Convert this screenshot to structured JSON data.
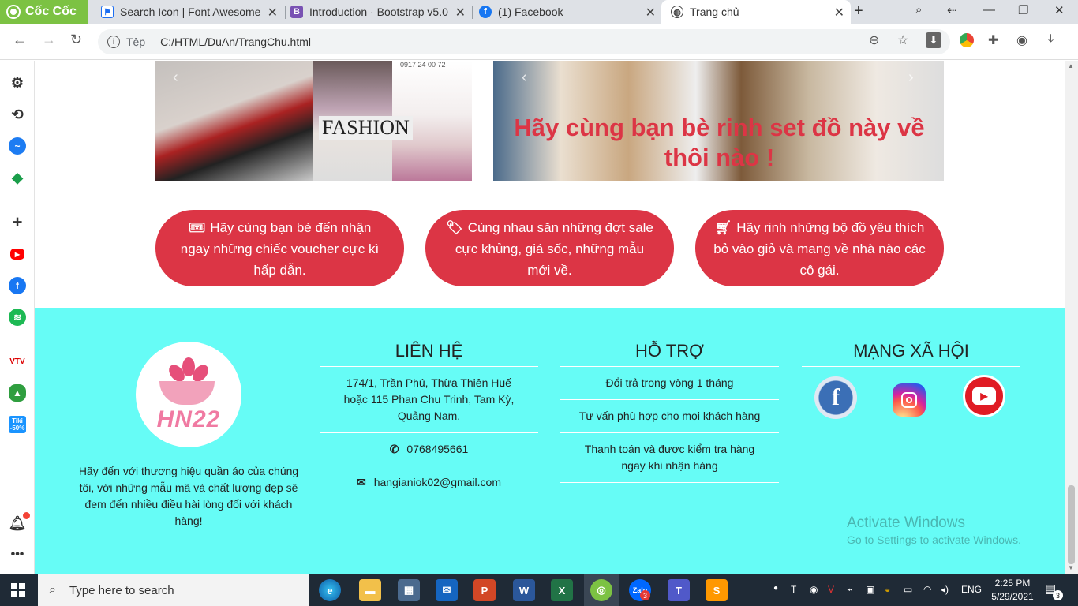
{
  "browser": {
    "brand": "Cốc Cốc",
    "tabs": [
      {
        "label": "Search Icon | Font Awesome",
        "icon": "flag-icon"
      },
      {
        "label": "Introduction · Bootstrap v5.0",
        "icon": "bootstrap-icon"
      },
      {
        "label": "(1) Facebook",
        "icon": "facebook-icon"
      },
      {
        "label": "Trang chủ",
        "icon": "globe-icon"
      }
    ],
    "address_label": "Tệp",
    "url": "C:/HTML/DuAn/TrangChu.html"
  },
  "banner": {
    "left_text": "FASHION",
    "right_caption": "Hãy cùng bạn bè rinh set đồ này về thôi nào !",
    "phone_fragment": "0917 24 00 72"
  },
  "promos": [
    {
      "icon": "ticket-icon",
      "text": "Hãy cùng bạn bè đến nhận ngay những chiếc voucher cực kì hấp dẫn."
    },
    {
      "icon": "tags-icon",
      "text": "Cùng nhau săn những đợt sale cực khủng, giá sốc, những mẫu mới về."
    },
    {
      "icon": "cart-icon",
      "text": "Hãy rinh những bộ đồ yêu thích bỏ vào giỏ và mang về nhà nào các cô gái."
    }
  ],
  "footer": {
    "logo_text": "HN22",
    "about": "Hãy đến với thương hiệu quần áo của chúng tôi, với những mẫu mã và chất lượng đẹp sẽ đem đến nhiều điều hài lòng đối với khách hàng!",
    "contact": {
      "title": "LIÊN HỆ",
      "address": "174/1, Trần Phú, Thừa Thiên Huế hoặc 115 Phan Chu Trinh, Tam Kỳ, Quảng Nam.",
      "phone": "0768495661",
      "email": "hangianiok02@gmail.com"
    },
    "support": {
      "title": "HỖ TRỢ",
      "items": [
        "Đổi trả trong vòng 1 tháng",
        "Tư vấn phù hợp cho mọi khách hàng",
        "Thanh toán và được kiểm tra hàng ngay khi nhận hàng"
      ]
    },
    "social": {
      "title": "MẠNG XÃ HỘI",
      "facebook_letter": "f"
    }
  },
  "watermark": {
    "line1": "Activate Windows",
    "line2": "Go to Settings to activate Windows."
  },
  "taskbar": {
    "search_placeholder": "Type here to search",
    "language": "ENG",
    "time": "2:25 PM",
    "date": "5/29/2021",
    "notification_count": "3",
    "zalo_badge": "3"
  },
  "colors": {
    "accent": "#dc3545",
    "footer_bg": "#66fcf6",
    "coccoc_green": "#7cc243"
  }
}
